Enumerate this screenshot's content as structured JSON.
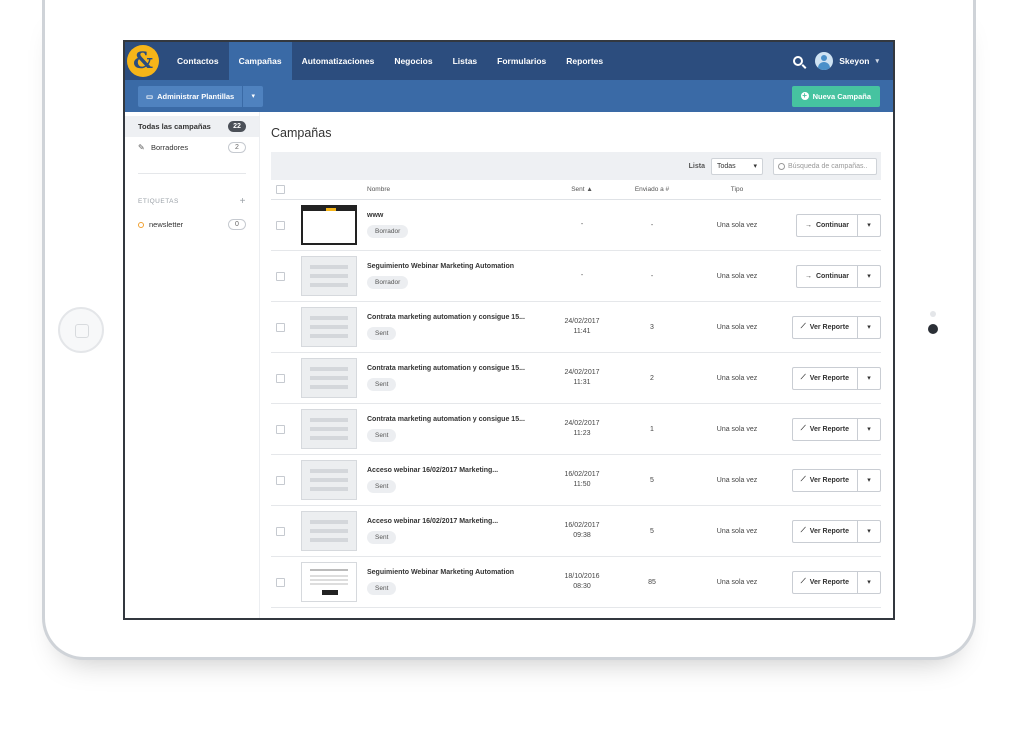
{
  "brand": {
    "logo_text": "&",
    "accent": "#f6b519",
    "navbar_color": "#2c4d7e",
    "subbar_color": "#3a6aa6",
    "new_button_color": "#46c3a0"
  },
  "nav": {
    "items": [
      {
        "label": "Contactos",
        "active": false
      },
      {
        "label": "Campañas",
        "active": true
      },
      {
        "label": "Automatizaciones",
        "active": false
      },
      {
        "label": "Negocios",
        "active": false
      },
      {
        "label": "Listas",
        "active": false
      },
      {
        "label": "Formularios",
        "active": false
      },
      {
        "label": "Reportes",
        "active": false
      }
    ],
    "search_icon": "search-icon",
    "user_name": "Skeyon"
  },
  "toolbar": {
    "admin_label": "Administrar Plantillas",
    "new_label": "Nueva Campaña"
  },
  "sidebar": {
    "all_label": "Todas las campañas",
    "all_count": "22",
    "drafts_label": "Borradores",
    "drafts_count": "2",
    "tags_header": "ETIQUETAS",
    "tags": [
      {
        "label": "newsletter",
        "count": "0"
      }
    ]
  },
  "main": {
    "title": "Campañas",
    "filter_label": "Lista",
    "filter_value": "Todas",
    "search_placeholder": "Búsqueda de campañas..",
    "columns": {
      "name": "Nombre",
      "sent": "Sent ▲",
      "sent_to": "Enviado a #",
      "type": "Tipo"
    },
    "rows": [
      {
        "thumb": "email",
        "name": "www",
        "status": "Borrador",
        "date": "-",
        "time": "",
        "sent_to": "-",
        "type": "Una sola vez",
        "action": "Continuar",
        "action_icon": "→"
      },
      {
        "thumb": "grey",
        "name": "Seguimiento Webinar Marketing Automation",
        "status": "Borrador",
        "date": "-",
        "time": "",
        "sent_to": "-",
        "type": "Una sola vez",
        "action": "Continuar",
        "action_icon": "→"
      },
      {
        "thumb": "grey",
        "name": "Contrata marketing automation y consigue 15...",
        "status": "Sent",
        "date": "24/02/2017",
        "time": "11:41",
        "sent_to": "3",
        "type": "Una sola vez",
        "action": "Ver Reporte",
        "action_icon": "📈"
      },
      {
        "thumb": "grey",
        "name": "Contrata marketing automation y consigue 15...",
        "status": "Sent",
        "date": "24/02/2017",
        "time": "11:31",
        "sent_to": "2",
        "type": "Una sola vez",
        "action": "Ver Reporte",
        "action_icon": "📈"
      },
      {
        "thumb": "grey",
        "name": "Contrata marketing automation y consigue 15...",
        "status": "Sent",
        "date": "24/02/2017",
        "time": "11:23",
        "sent_to": "1",
        "type": "Una sola vez",
        "action": "Ver Reporte",
        "action_icon": "📈"
      },
      {
        "thumb": "grey",
        "name": "Acceso webinar 16/02/2017 Marketing...",
        "status": "Sent",
        "date": "16/02/2017",
        "time": "11:50",
        "sent_to": "5",
        "type": "Una sola vez",
        "action": "Ver Reporte",
        "action_icon": "📈"
      },
      {
        "thumb": "grey",
        "name": "Acceso webinar 16/02/2017 Marketing...",
        "status": "Sent",
        "date": "16/02/2017",
        "time": "09:38",
        "sent_to": "5",
        "type": "Una sola vez",
        "action": "Ver Reporte",
        "action_icon": "📈"
      },
      {
        "thumb": "doc",
        "name": "Seguimiento Webinar Marketing Automation",
        "status": "Sent",
        "date": "18/10/2016",
        "time": "08:30",
        "sent_to": "85",
        "type": "Una sola vez",
        "action": "Ver Reporte",
        "action_icon": "📈"
      }
    ]
  }
}
